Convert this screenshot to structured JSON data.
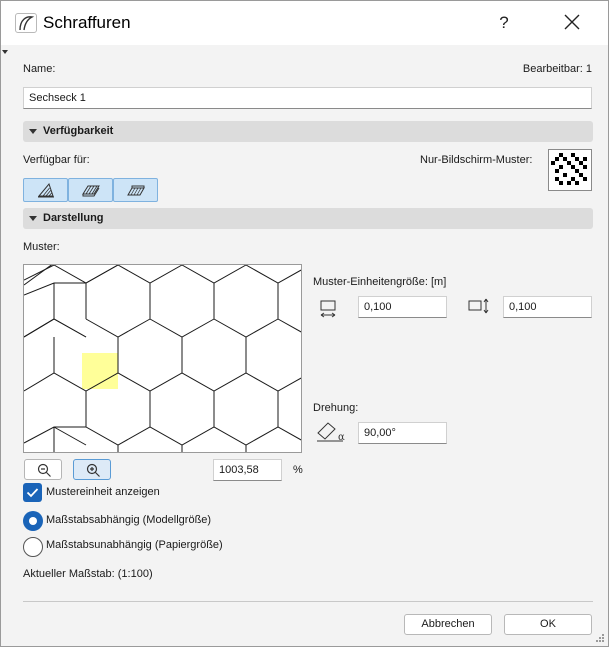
{
  "window": {
    "title": "Schraffuren"
  },
  "name_row": {
    "name_label": "Name:",
    "editable_label": "Bearbeitbar: 1",
    "name_value": "Sechseck 1"
  },
  "availability": {
    "section_title": "Verfügbarkeit",
    "available_for_label": "Verfügbar für:",
    "screen_pattern_label": "Nur-Bildschirm-Muster:"
  },
  "display": {
    "section_title": "Darstellung",
    "pattern_label": "Muster:",
    "unit_size_label": "Muster-Einheitengröße: [m]",
    "width_value": "0,100",
    "height_value": "0,100",
    "rotation_label": "Drehung:",
    "rotation_value": "90,00°",
    "zoom_value": "1003,58",
    "zoom_unit": "%"
  },
  "options": {
    "show_unit_label": "Mustereinheit anzeigen",
    "show_unit_checked": true,
    "scale_dependent_label": "Maßstabsabhängig (Modellgröße)",
    "scale_independent_label": "Maßstabsunabhängig (Papiergröße)",
    "selected_mode": "scale_dependent",
    "current_scale_label": "Aktueller Maßstab: (1:100)"
  },
  "buttons": {
    "cancel": "Abbrechen",
    "ok": "OK"
  },
  "colors": {
    "accent": "#1a64b8",
    "unit_highlight": "#ffff99",
    "section_bg": "#dcdcdc"
  }
}
